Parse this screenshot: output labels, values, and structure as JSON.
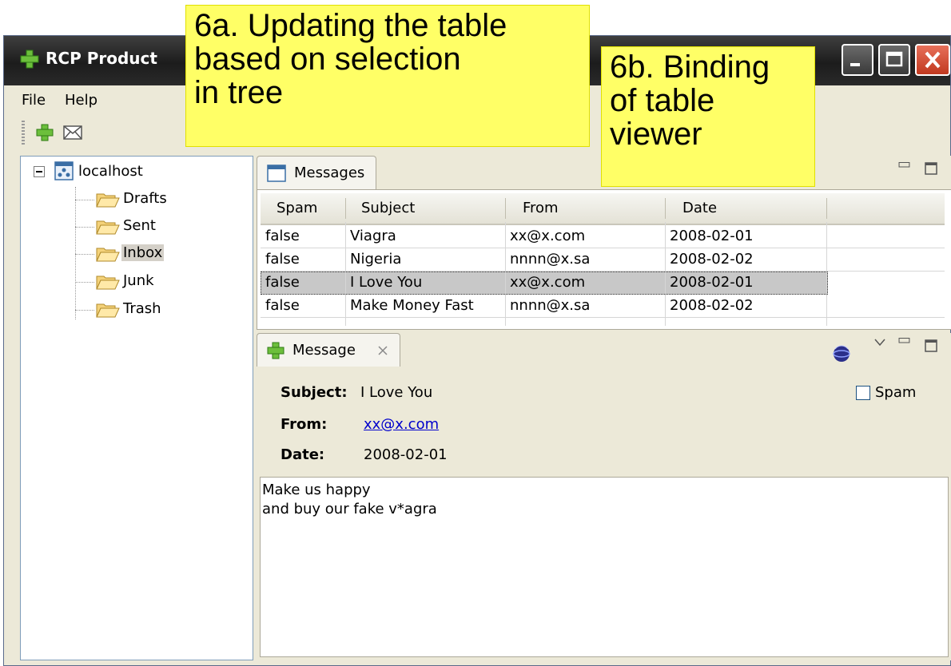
{
  "window": {
    "title": "RCP Product"
  },
  "menu": {
    "file": "File",
    "help": "Help"
  },
  "toolbar": {
    "add_icon": "plus-icon",
    "mail_icon": "envelope-icon"
  },
  "tree": {
    "root": "localhost",
    "folders": [
      "Drafts",
      "Sent",
      "Inbox",
      "Junk",
      "Trash"
    ],
    "selected": "Inbox"
  },
  "messages_view": {
    "tab_label": "Messages",
    "columns": [
      "Spam",
      "Subject",
      "From",
      "Date"
    ],
    "rows": [
      [
        "false",
        "Viagra",
        "xx@x.com",
        "2008-02-01"
      ],
      [
        "false",
        "Nigeria",
        "nnnn@x.sa",
        "2008-02-02"
      ],
      [
        "false",
        "I Love You",
        "xx@x.com",
        "2008-02-01"
      ],
      [
        "false",
        "Make Money Fast",
        "nnnn@x.sa",
        "2008-02-02"
      ]
    ],
    "selected_row": 2
  },
  "message_view": {
    "tab_label": "Message",
    "subject_label": "Subject:",
    "subject": "I Love You",
    "from_label": "From:",
    "from": "xx@x.com",
    "date_label": "Date:",
    "date": "2008-02-01",
    "spam_label": "Spam",
    "spam_checked": false,
    "body": "Make us happy\nand buy our fake v*agra"
  },
  "callouts": {
    "a": "6a. Updating the table\nbased on selection\nin tree",
    "b": "6b. Binding\nof table\nviewer"
  }
}
